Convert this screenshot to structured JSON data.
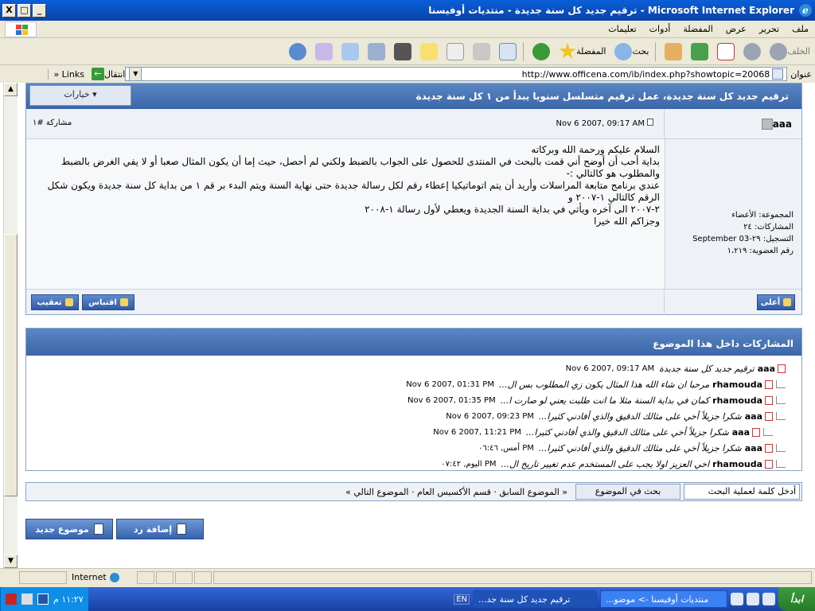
{
  "window": {
    "title": "ترقيم جديد كل سنة جديدة - منتديات أوفيسنا - Microsoft Internet Explorer",
    "min": "_",
    "max": "□",
    "close": "X"
  },
  "menu": [
    "ملف",
    "تحرير",
    "عرض",
    "المفضلة",
    "أدوات",
    "تعليمات"
  ],
  "toolbar": {
    "back": "الخلف",
    "search": "بحث",
    "favorites": "المفضلة"
  },
  "address": {
    "label": "عنوان",
    "url": "http://www.officena.com/ib/index.php?showtopic=20068",
    "go": "انتقال",
    "links": "Links"
  },
  "post": {
    "title": "ترقيم جديد كل سنة جديدة، عمل ترقيم متسلسل سنويا يبدأ من ١ كل سنة جديدة",
    "options": "خيارات ▾",
    "author": "aaa",
    "date": "Nov 6 2007, 09:17 AM",
    "number": "مشاركة #١",
    "lines": [
      "السلام عليكم ورحمة الله وبركاته",
      "بداية أحب أن أوضح أني قمت بالبحث في المنتدى للحصول على الجواب بالضبط ولكني لم أحصل، حيث إما أن يكون المثال صعبا أو لا يفي الغرض بالضبط",
      "والمطلوب هو كالتالي :-",
      "عندي برنامج متابعة المراسلات وأريد أن يتم اتوماتيكيا إعطاء رقم لكل رسالة جديدة حتى نهاية السنة ويتم البدء بر قم ١ من بداية كل سنة جديدة ويكون شكل الرقم كالتالي ١-٢٠٠٧ و",
      "٢-٢٠٠٧ الى آخره ويأتي في بداية السنة الجديدة ويعطي لأول رسالة ١-٢٠٠٨",
      "وجزاكم الله خيرا"
    ],
    "side": [
      "المجموعة: الأعضاء",
      "المشاركات: ٢٤",
      "التسجيل: ٢٩-03 September",
      "رقم العضوية: ١،٢١٩"
    ],
    "top_btn": "أعلى",
    "quote_btn": "اقتباس",
    "reply_btn": "تعقيب"
  },
  "thread": {
    "title": "المشاركات داخل هذا الموضوع",
    "rows": [
      {
        "name": "aaa",
        "title": "ترقيم جديد كل سنة جديدة",
        "date": "Nov 6 2007, 09:17 AM"
      },
      {
        "name": "rhamouda",
        "title": "مرحبا ان شاء الله هذا المثال يكون زي المطلوب بس ال...",
        "date": "Nov 6 2007, 01:31 PM"
      },
      {
        "name": "rhamouda",
        "title": "كمان في بداية السنة مثلا ما انت طلبت يعني لو صارت ا...",
        "date": "Nov 6 2007, 01:35 PM"
      },
      {
        "name": "aaa",
        "title": "شكرا جزيلاً أخي على مثالك الدقيق والذي أفادني كثيرا...",
        "date": "Nov 6 2007, 09:23 PM"
      },
      {
        "name": "aaa",
        "title": "شكرا جزيلاً أخي على مثالك الدقيق والذي أفادني كثيرا...",
        "date": "Nov 6 2007, 11:21 PM"
      },
      {
        "name": "aaa",
        "title": "شكرا جزيلاً أخي على مثالك الدقيق والذي أفادني كثيرا...",
        "date": "أمس, ٠٦:٤٦ PM"
      },
      {
        "name": "rhamouda",
        "title": "اخي العزيز اولا يجب على المستخدم عدم تغيير تاريخ ال...",
        "date": "اليوم, ٠٧:٤٢ PM"
      }
    ]
  },
  "nav": {
    "search_placeholder": "أدخل كلمة لعملية البحث",
    "search_btn": "بحث في الموضوع",
    "links": "« الموضوع السابق · قسم الأكسيس العام · الموضوع التالي »"
  },
  "buttons": {
    "add_reply": "إضافة رد",
    "new_topic": "موضوع جديد"
  },
  "status": {
    "zone": "Internet"
  },
  "taskbar": {
    "start": "ابدأ",
    "task1": "منتديات أوفيسنا -> موضو...",
    "task2": "ترقيم جديد كل سنة جد...",
    "clock": "١١:٢٧ م",
    "lang": "EN"
  }
}
